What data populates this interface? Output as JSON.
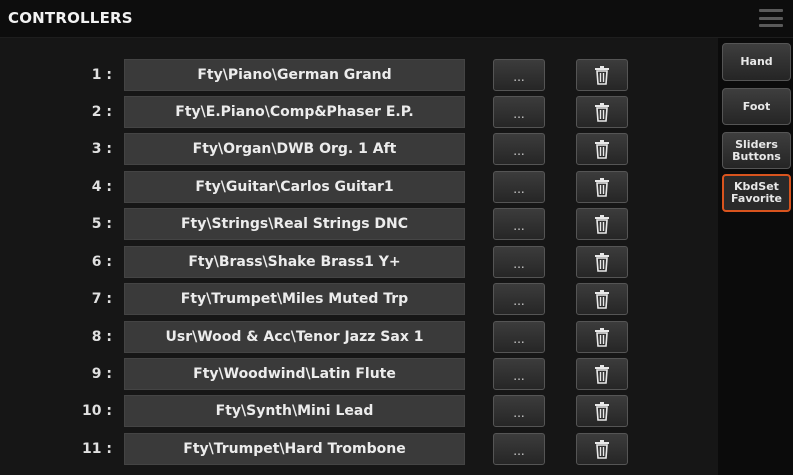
{
  "header": {
    "title": "CONTROLLERS",
    "menu_icon": "menu-icon"
  },
  "controllers": [
    {
      "number": "1 :",
      "sound": "Fty\\Piano\\German Grand",
      "more_label": "...",
      "delete_icon": "trash-icon"
    },
    {
      "number": "2 :",
      "sound": "Fty\\E.Piano\\Comp&Phaser E.P.",
      "more_label": "...",
      "delete_icon": "trash-icon"
    },
    {
      "number": "3 :",
      "sound": "Fty\\Organ\\DWB Org. 1 Aft",
      "more_label": "...",
      "delete_icon": "trash-icon"
    },
    {
      "number": "4 :",
      "sound": "Fty\\Guitar\\Carlos Guitar1",
      "more_label": "...",
      "delete_icon": "trash-icon"
    },
    {
      "number": "5 :",
      "sound": "Fty\\Strings\\Real Strings DNC",
      "more_label": "...",
      "delete_icon": "trash-icon"
    },
    {
      "number": "6 :",
      "sound": "Fty\\Brass\\Shake Brass1 Y+",
      "more_label": "...",
      "delete_icon": "trash-icon"
    },
    {
      "number": "7 :",
      "sound": "Fty\\Trumpet\\Miles Muted Trp",
      "more_label": "...",
      "delete_icon": "trash-icon"
    },
    {
      "number": "8 :",
      "sound": "Usr\\Wood & Acc\\Tenor Jazz Sax 1",
      "more_label": "...",
      "delete_icon": "trash-icon"
    },
    {
      "number": "9 :",
      "sound": "Fty\\Woodwind\\Latin Flute",
      "more_label": "...",
      "delete_icon": "trash-icon"
    },
    {
      "number": "10 :",
      "sound": "Fty\\Synth\\Mini Lead",
      "more_label": "...",
      "delete_icon": "trash-icon"
    },
    {
      "number": "11 :",
      "sound": "Fty\\Trumpet\\Hard Trombone",
      "more_label": "...",
      "delete_icon": "trash-icon"
    }
  ],
  "tabs": [
    {
      "label": "Hand",
      "label2": "",
      "active": false
    },
    {
      "label": "Foot",
      "label2": "",
      "active": false
    },
    {
      "label": "Sliders",
      "label2": "Buttons",
      "active": false
    },
    {
      "label": "KbdSet",
      "label2": "Favorite",
      "active": true
    }
  ],
  "colors": {
    "active_tab_border": "#d9541e",
    "field_bg": "#3a3a3a",
    "background": "#161616"
  }
}
